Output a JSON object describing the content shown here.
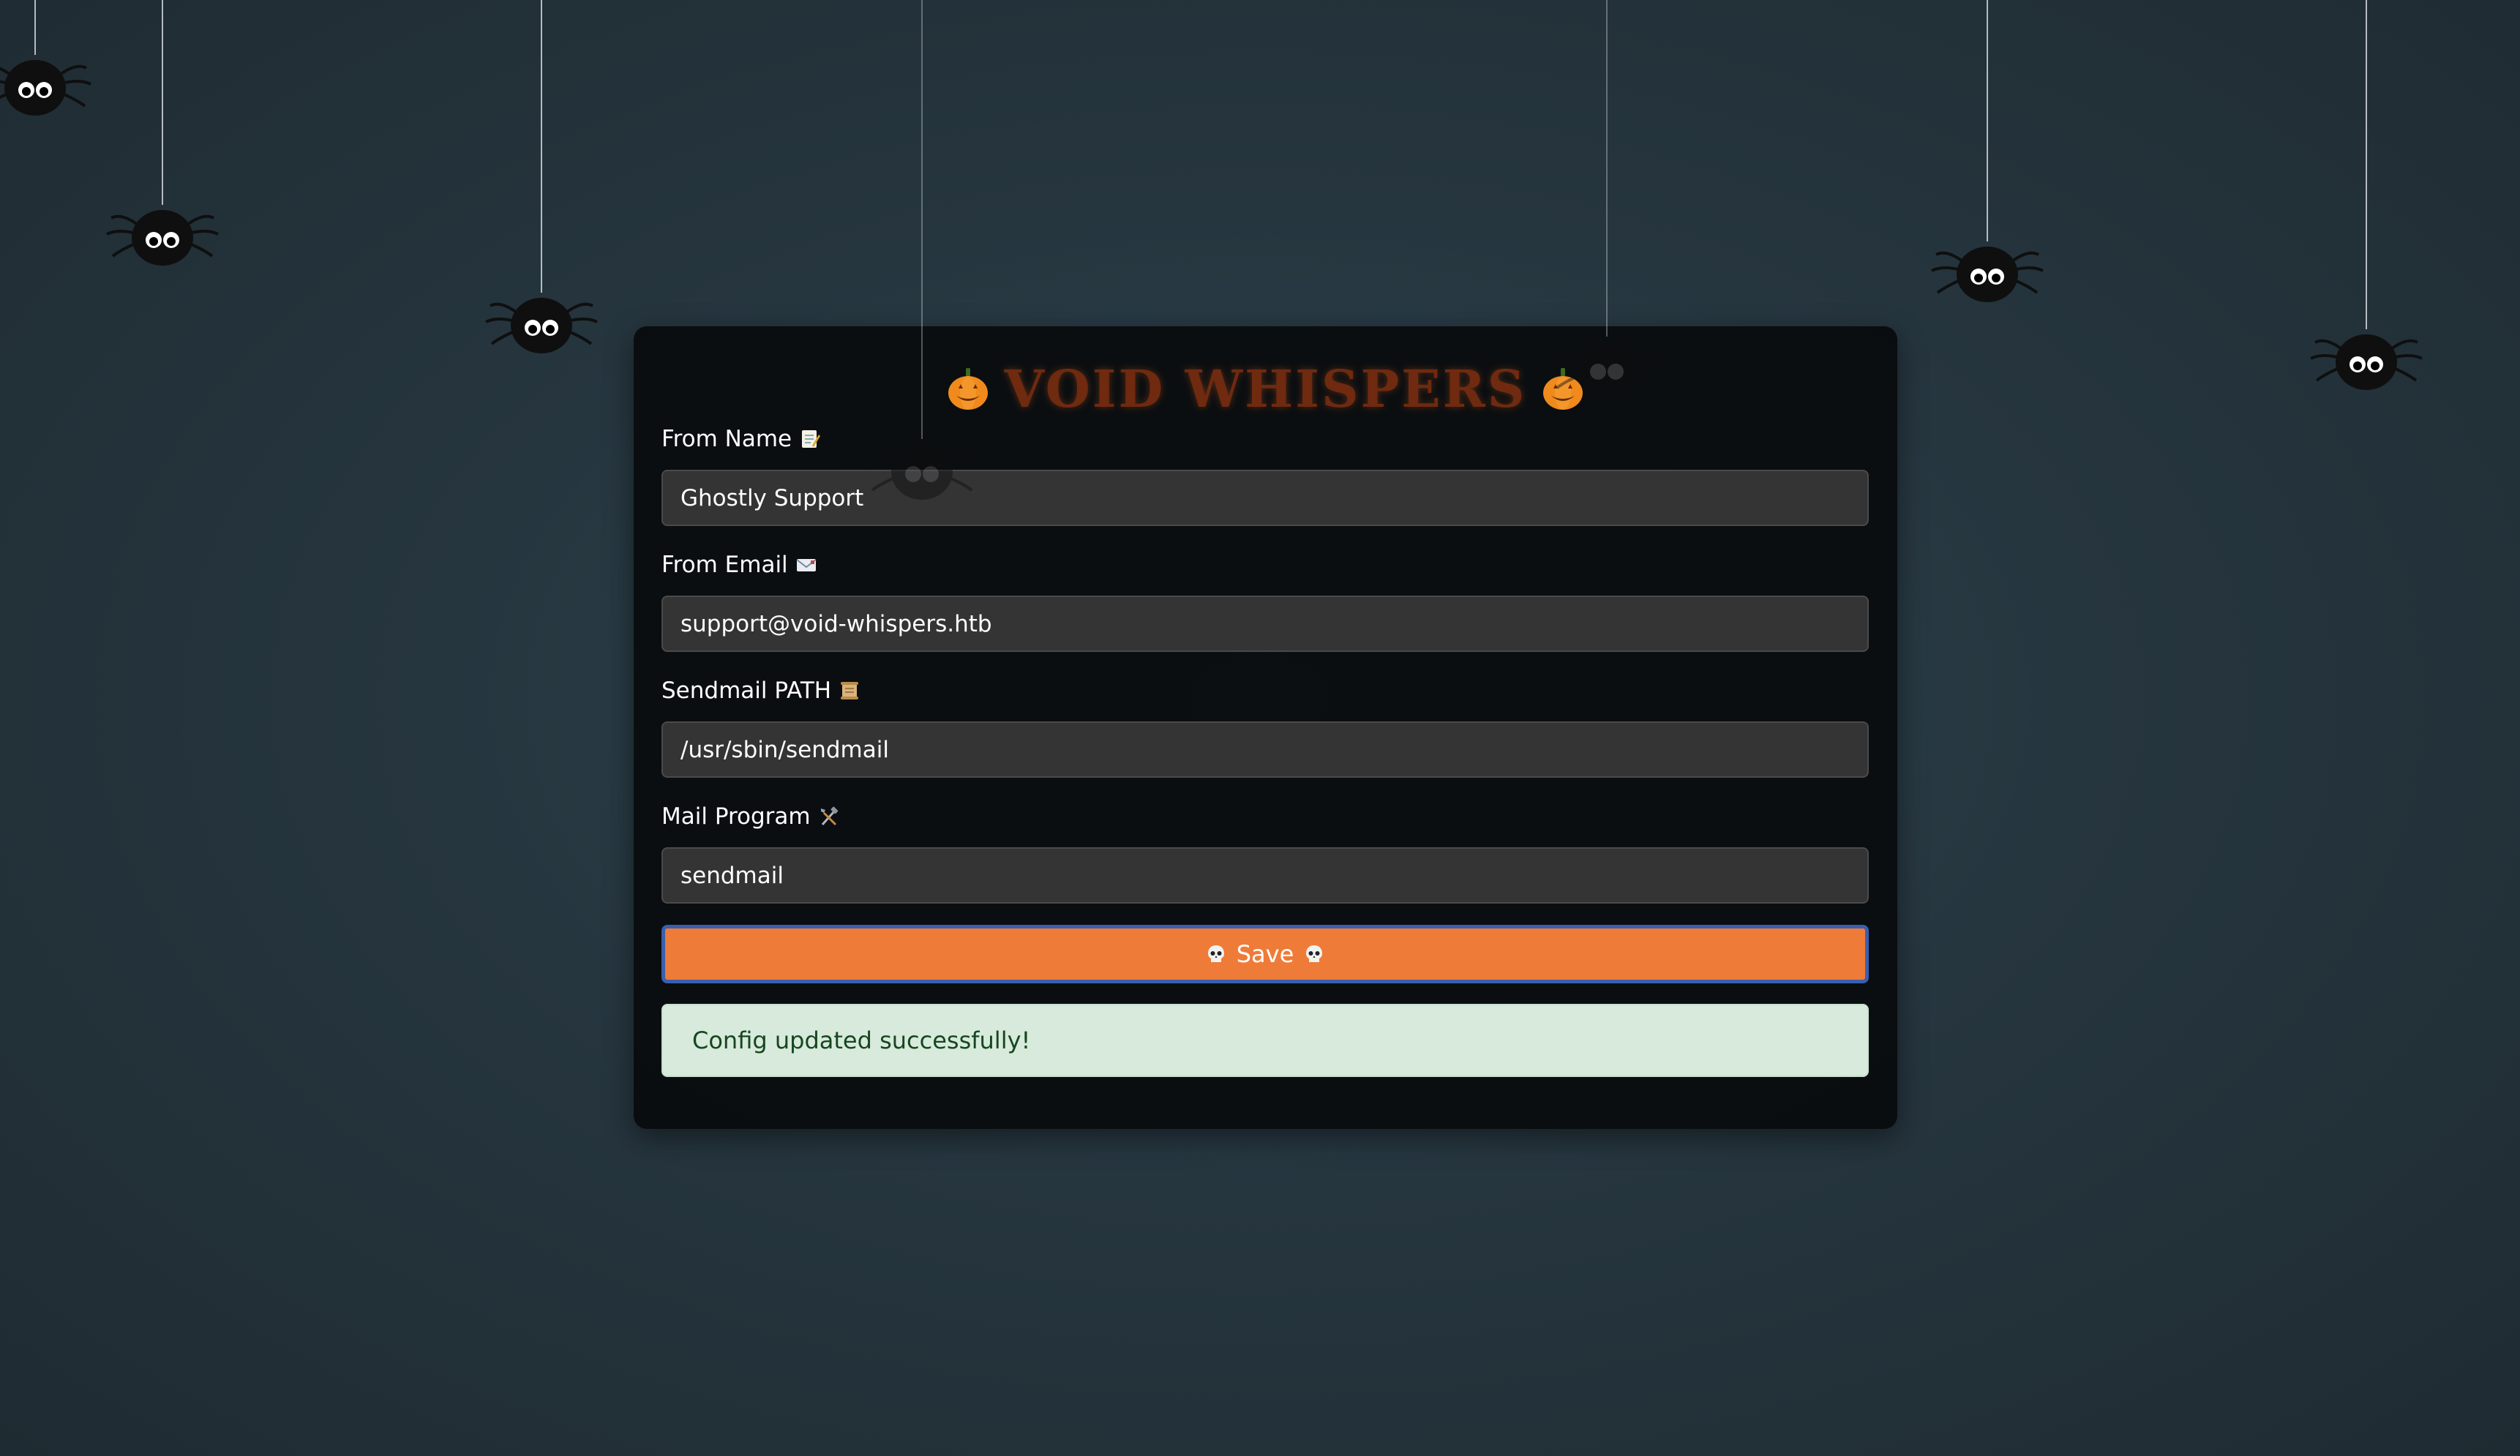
{
  "header": {
    "title": "VOID WHISPERS",
    "left_icon": "pumpkin-icon",
    "right_icon": "pumpkin-icon"
  },
  "form": {
    "from_name": {
      "label": "From Name",
      "icon": "memo-icon",
      "value": "Ghostly Support"
    },
    "from_email": {
      "label": "From Email",
      "icon": "envelope-icon",
      "value": "support@void-whispers.htb"
    },
    "sendmail_path": {
      "label": "Sendmail PATH",
      "icon": "scroll-icon",
      "value": "/usr/sbin/sendmail"
    },
    "mail_program": {
      "label": "Mail Program",
      "icon": "tools-icon",
      "value": "sendmail"
    },
    "save_button": {
      "label": "Save",
      "icon": "skull-icon"
    }
  },
  "status": {
    "message": "Config updated successfully!"
  },
  "colors": {
    "background": "#26363f",
    "card": "#0b0d0f",
    "input": "#343434",
    "button": "#ef7b38",
    "button_border": "#3a5fb0",
    "alert_bg": "#d7eadc",
    "alert_text": "#17461f",
    "title": "#7a2e10"
  },
  "decorations": {
    "spider_icon": "spider-icon"
  }
}
